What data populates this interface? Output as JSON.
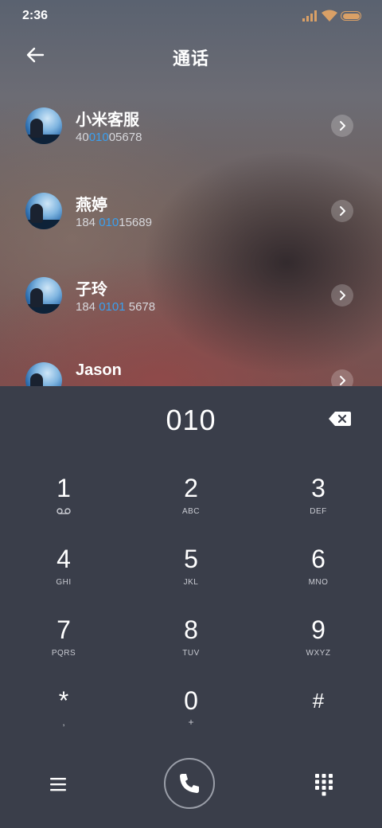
{
  "status": {
    "time": "2:36"
  },
  "header": {
    "title": "通话"
  },
  "contacts": [
    {
      "name": "小米客服",
      "num_pre": "40",
      "num_hl": "010",
      "num_post": "05678"
    },
    {
      "name": "燕婷",
      "num_pre": "184 ",
      "num_hl": "010",
      "num_post": "15689"
    },
    {
      "name": "子玲",
      "num_pre": "184 ",
      "num_hl": "0101",
      "num_post": " 5678"
    },
    {
      "name": "Jason",
      "num_pre": "",
      "num_hl": "",
      "num_post": ""
    }
  ],
  "dialer": {
    "input": "010",
    "keys": [
      {
        "digit": "1",
        "sub": ""
      },
      {
        "digit": "2",
        "sub": "ABC"
      },
      {
        "digit": "3",
        "sub": "DEF"
      },
      {
        "digit": "4",
        "sub": "GHI"
      },
      {
        "digit": "5",
        "sub": "JKL"
      },
      {
        "digit": "6",
        "sub": "MNO"
      },
      {
        "digit": "7",
        "sub": "PQRS"
      },
      {
        "digit": "8",
        "sub": "TUV"
      },
      {
        "digit": "9",
        "sub": "WXYZ"
      },
      {
        "digit": "*",
        "sub": ","
      },
      {
        "digit": "0",
        "sub": "+"
      },
      {
        "digit": "#",
        "sub": ""
      }
    ]
  },
  "colors": {
    "highlight": "#3aa0f0",
    "dialer_bg": "#3a3e4a",
    "battery": "#d9a066"
  },
  "icons": {
    "voicemail": "voicemail-icon",
    "backspace": "backspace-icon",
    "call": "phone-icon",
    "menu": "menu-icon",
    "dialpad": "dialpad-icon"
  }
}
